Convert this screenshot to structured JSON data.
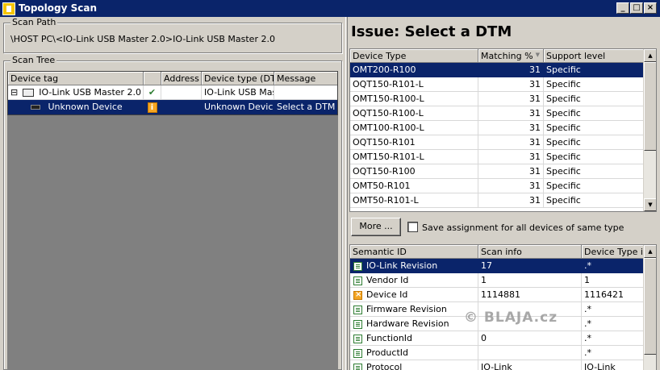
{
  "window": {
    "title": "Topology Scan",
    "controls": [
      "_",
      "□",
      "×"
    ]
  },
  "scan_path": {
    "label": "Scan Path",
    "value": "\\HOST PC\\<IO-Link USB Master 2.0>IO-Link USB Master 2.0"
  },
  "scan_tree": {
    "label": "Scan Tree",
    "columns": [
      "Device tag",
      "",
      "Address",
      "Device type (DTM",
      "Message"
    ],
    "rows": [
      {
        "tag": "IO-Link USB Master 2.0",
        "status": "✔",
        "address": "",
        "device_type": "IO-Link USB Mas",
        "message": "",
        "expander": "⊟"
      },
      {
        "tag": "Unknown Device",
        "status": "i",
        "address": "",
        "device_type": "Unknown Device",
        "message": "Select a DTM"
      }
    ]
  },
  "issue": {
    "title": "Issue: Select a DTM",
    "columns": [
      "Device Type",
      "Matching %",
      "Support level"
    ],
    "sort_indicator": "▼",
    "rows": [
      {
        "type": "OMT200-R100",
        "match": "31",
        "level": "Specific"
      },
      {
        "type": "OQT150-R101-L",
        "match": "31",
        "level": "Specific"
      },
      {
        "type": "OMT150-R100-L",
        "match": "31",
        "level": "Specific"
      },
      {
        "type": "OQT150-R100-L",
        "match": "31",
        "level": "Specific"
      },
      {
        "type": "OMT100-R100-L",
        "match": "31",
        "level": "Specific"
      },
      {
        "type": "OQT150-R101",
        "match": "31",
        "level": "Specific"
      },
      {
        "type": "OMT150-R101-L",
        "match": "31",
        "level": "Specific"
      },
      {
        "type": "OQT150-R100",
        "match": "31",
        "level": "Specific"
      },
      {
        "type": "OMT50-R101",
        "match": "31",
        "level": "Specific"
      },
      {
        "type": "OMT50-R101-L",
        "match": "31",
        "level": "Specific"
      }
    ],
    "more_button": "More ...",
    "save_assignment": "Save assignment for all devices of same type"
  },
  "semantic": {
    "columns": [
      "Semantic ID",
      "Scan info",
      "Device Type in"
    ],
    "rows": [
      {
        "id": "IO-Link Revision",
        "scan": "17",
        "dev": ".*",
        "icon": "ok"
      },
      {
        "id": "Vendor Id",
        "scan": "1",
        "dev": "1",
        "icon": "ok"
      },
      {
        "id": "Device Id",
        "scan": "1114881",
        "dev": "1116421",
        "icon": "warn"
      },
      {
        "id": "Firmware Revision",
        "scan": "",
        "dev": ".*",
        "icon": "ok"
      },
      {
        "id": "Hardware Revision",
        "scan": "",
        "dev": ".*",
        "icon": "ok"
      },
      {
        "id": "FunctionId",
        "scan": "0",
        "dev": ".*",
        "icon": "ok"
      },
      {
        "id": "ProductId",
        "scan": "",
        "dev": ".*",
        "icon": "ok"
      },
      {
        "id": "Protocol",
        "scan": "IO-Link",
        "dev": "IO-Link",
        "icon": "ok"
      }
    ]
  },
  "watermark": "© BLAJA.cz"
}
